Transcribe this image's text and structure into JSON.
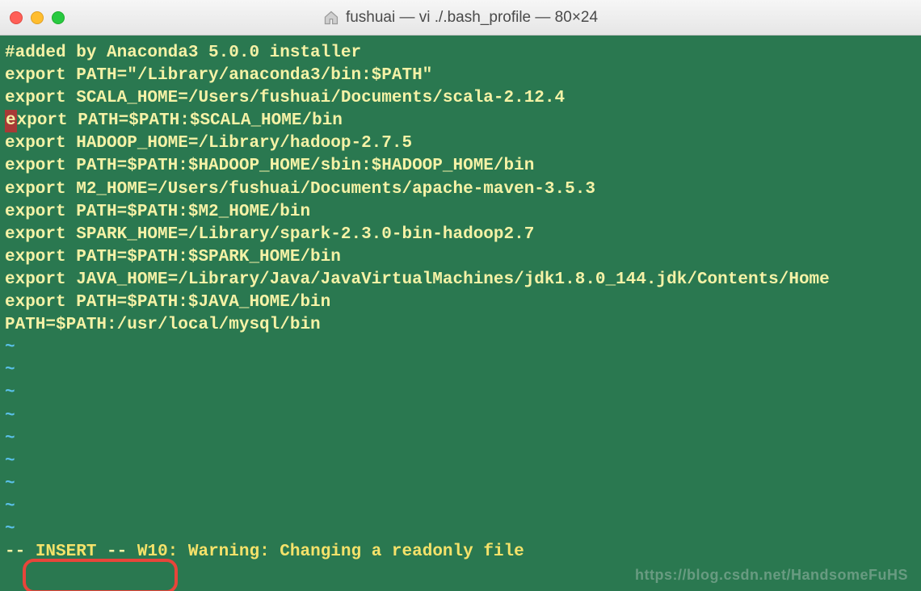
{
  "window": {
    "title": "fushuai — vi ./.bash_profile — 80×24"
  },
  "terminal": {
    "lines": [
      "#added by Anaconda3 5.0.0 installer",
      "export PATH=\"/Library/anaconda3/bin:$PATH\"",
      "export SCALA_HOME=/Users/fushuai/Documents/scala-2.12.4",
      "export PATH=$PATH:$SCALA_HOME/bin",
      "export HADOOP_HOME=/Library/hadoop-2.7.5",
      "export PATH=$PATH:$HADOOP_HOME/sbin:$HADOOP_HOME/bin",
      "export M2_HOME=/Users/fushuai/Documents/apache-maven-3.5.3",
      "export PATH=$PATH:$M2_HOME/bin",
      "export SPARK_HOME=/Library/spark-2.3.0-bin-hadoop2.7",
      "export PATH=$PATH:$SPARK_HOME/bin",
      "export JAVA_HOME=/Library/Java/JavaVirtualMachines/jdk1.8.0_144.jdk/Contents/Home",
      "export PATH=$PATH:$JAVA_HOME/bin",
      "PATH=$PATH:/usr/local/mysql/bin"
    ],
    "cursor_line_index": 3,
    "tilde": "~",
    "tilde_count": 9,
    "status": {
      "prefix": "-- ",
      "mode": "INSERT",
      "suffix": " -- ",
      "warning": "W10: Warning: Changing a readonly file"
    }
  },
  "watermark": "https://blog.csdn.net/HandsomeFuHS"
}
